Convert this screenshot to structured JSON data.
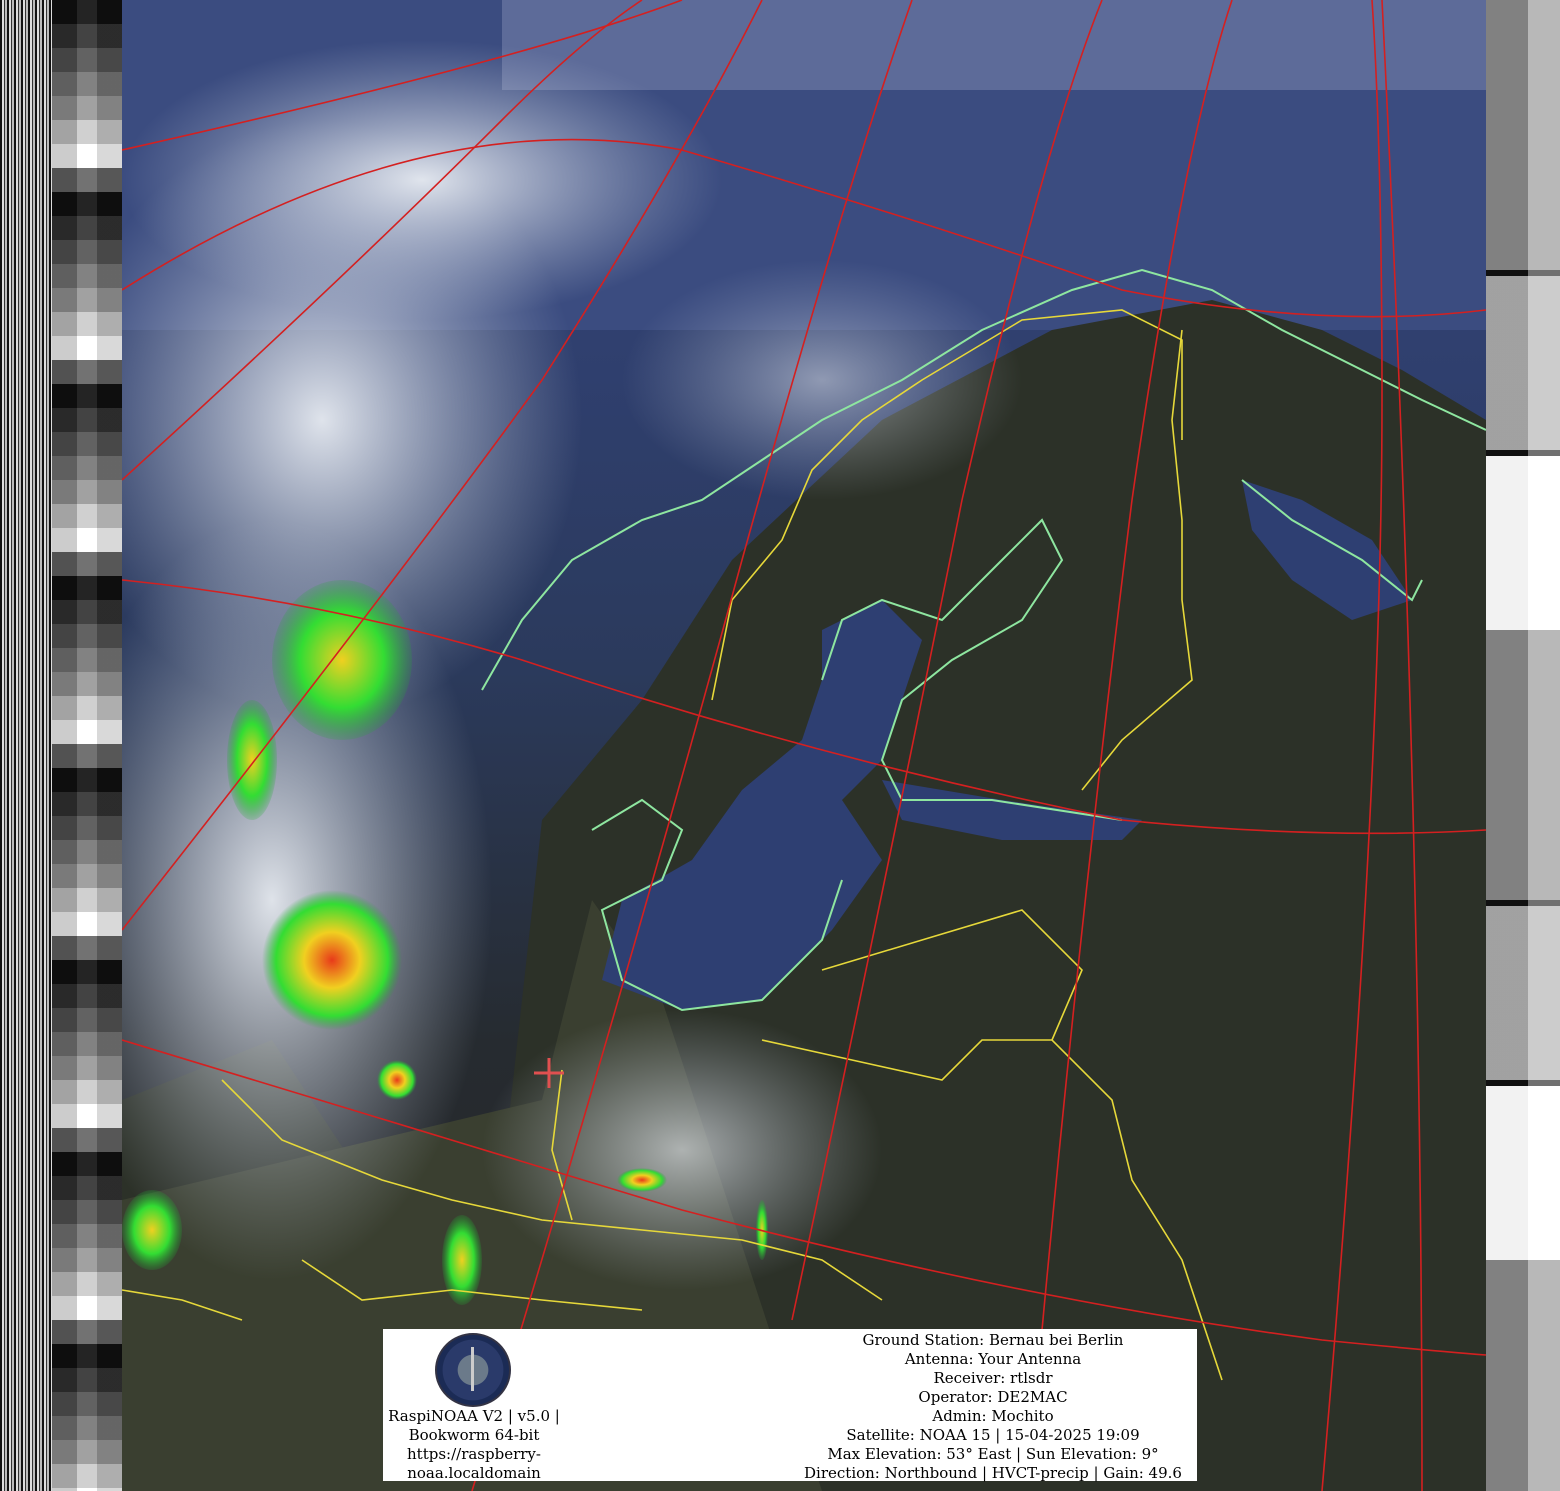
{
  "colors": {
    "grid": "#d42020",
    "coast": "#8ee6a0",
    "borders": "#e6d83a",
    "sea": "#2e3f72",
    "land_night": "#262626",
    "precip_heavy": "#e83a1a",
    "precip_medium": "#f0d020",
    "precip_light": "#22cc33"
  },
  "icons": {
    "logo": "raspinoaa-logo",
    "ground_station_marker": "cross-marker"
  },
  "info_panel": {
    "left_lines": [
      "RaspiNOAA V2 | v5.0 |",
      "Bookworm 64-bit",
      "https://raspberry-",
      "noaa.localdomain"
    ],
    "right_lines": [
      "Ground Station: Bernau bei Berlin",
      "Antenna: Your Antenna",
      "Receiver: rtlsdr",
      "Operator: DE2MAC",
      "Admin: Mochito",
      "Satellite: NOAA 15 | 15-04-2025 19:09",
      "Max Elevation: 53° East | Sun Elevation: 9°",
      "Direction: Northbound | HVCT-precip | Gain: 49.6"
    ]
  }
}
